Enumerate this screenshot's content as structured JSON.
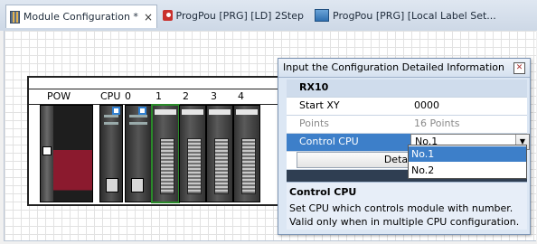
{
  "tabs": [
    {
      "label": "Module Configuration *",
      "close": "×",
      "icon": "module-config-icon"
    },
    {
      "label": "ProgPou [PRG] [LD] 2Step",
      "icon": "ladder-program-icon"
    },
    {
      "label": "ProgPou [PRG] [Local Label Set...",
      "icon": "local-label-icon"
    }
  ],
  "base": {
    "slots": [
      "POW",
      "CPU",
      "0",
      "1",
      "2",
      "3",
      "4"
    ]
  },
  "dialog": {
    "title": "Input the Configuration Detailed Information",
    "close": "✕",
    "group": "RX10",
    "rows": [
      {
        "key": "Start XY",
        "value": "0000"
      },
      {
        "key": "Points",
        "value": "16 Points"
      },
      {
        "key": "Control CPU",
        "value": "No.1"
      }
    ],
    "detail_button": "Detaile",
    "dropdown_options": [
      "No.1",
      "No.2"
    ],
    "help": {
      "heading": "Control CPU",
      "line1": "Set CPU which controls module with number.",
      "line2": "Valid only when in multiple CPU configuration."
    }
  },
  "colors": {
    "selection": "#3d7fc9",
    "handle": "#2f7fd0",
    "module_selected": "#2a8a2a",
    "power_module": "#8b1a2e"
  }
}
